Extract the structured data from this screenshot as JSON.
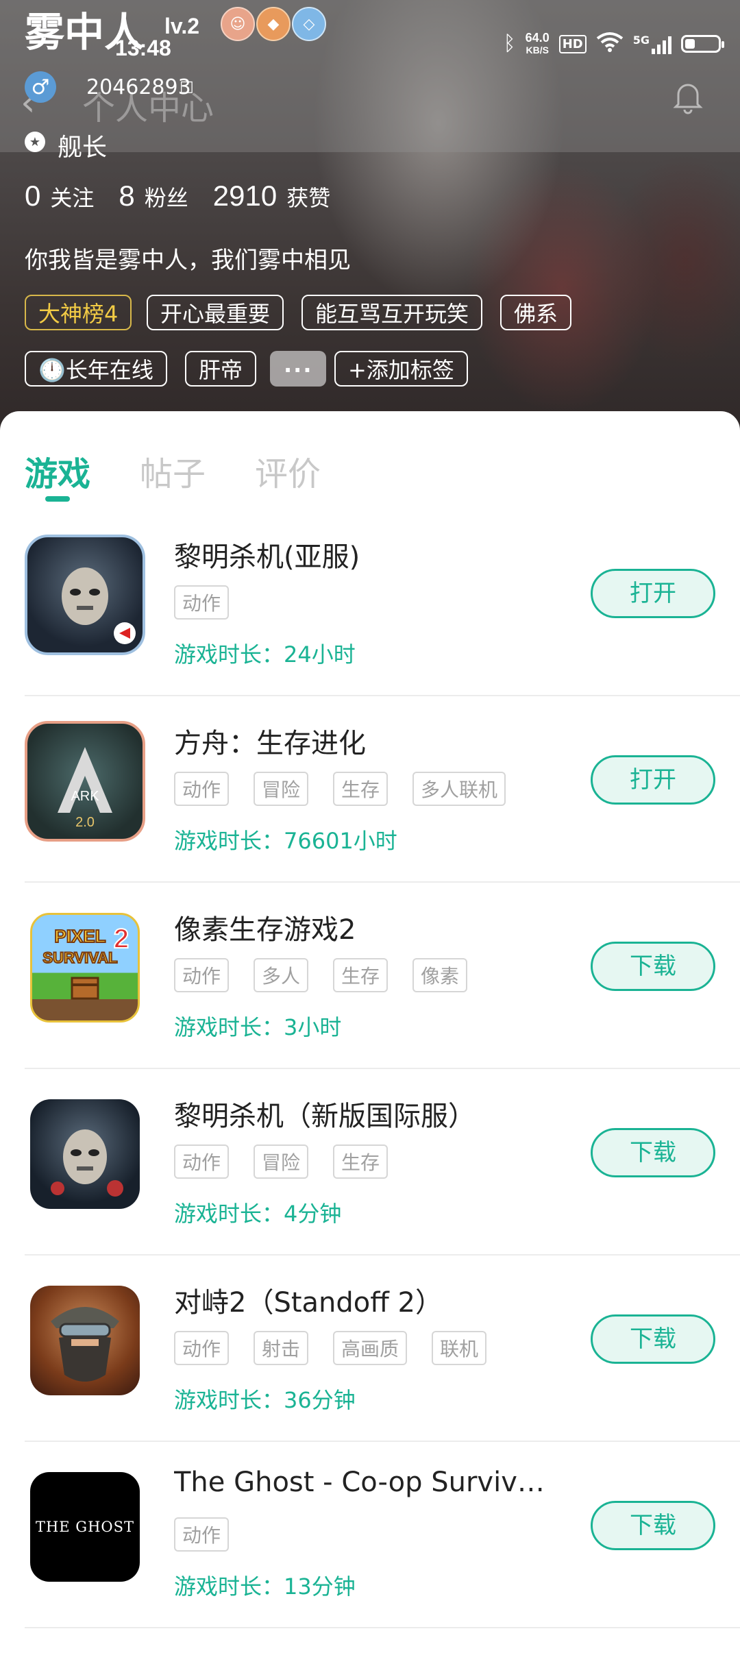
{
  "status_bar": {
    "time": "13:48",
    "net_speed_value": "64.0",
    "net_speed_unit": "KB/S",
    "hd": "HD",
    "signal": "5G",
    "battery_level": 0.3
  },
  "profile": {
    "username": "雾中人",
    "level": "lv.2",
    "header_title": "个人中心",
    "user_id": "20462893",
    "rank": "舰长",
    "stats": [
      {
        "num": "0",
        "label": "关注"
      },
      {
        "num": "8",
        "label": "粉丝"
      },
      {
        "num": "2910",
        "label": "获赞"
      }
    ],
    "bio": "你我皆是雾中人，我们雾中相见",
    "tags": [
      "大神榜4",
      "开心最重要",
      "能互骂互开玩笑",
      "佛系",
      "🕛长年在线",
      "肝帝",
      "···",
      "+添加标签"
    ]
  },
  "tabs": [
    "游戏",
    "帖子",
    "评价"
  ],
  "games": [
    {
      "name": "黎明杀机(亚服)",
      "tags": [
        "动作"
      ],
      "playtime": "游戏时长：24小时",
      "button": "打开"
    },
    {
      "name": "方舟：生存进化",
      "tags": [
        "动作",
        "冒险",
        "生存",
        "多人联机"
      ],
      "playtime": "游戏时长：76601小时",
      "button": "打开"
    },
    {
      "name": "像素生存游戏2",
      "tags": [
        "动作",
        "多人",
        "生存",
        "像素"
      ],
      "playtime": "游戏时长：3小时",
      "button": "下载"
    },
    {
      "name": "黎明杀机（新版国际服）",
      "tags": [
        "动作",
        "冒险",
        "生存"
      ],
      "playtime": "游戏时长：4分钟",
      "button": "下载"
    },
    {
      "name": "对峙2（Standoff 2）",
      "tags": [
        "动作",
        "射击",
        "高画质",
        "联机"
      ],
      "playtime": "游戏时长：36分钟",
      "button": "下载"
    },
    {
      "name": "The Ghost - Co-op Survival H...",
      "tags": [
        "动作"
      ],
      "playtime": "游戏时长：13分钟",
      "button": "下载"
    }
  ],
  "icon_texts": {
    "ark": "ARK",
    "ark_version": "2.0",
    "pixel_line1": "PIXEL",
    "pixel_line2": "SURVIVAL",
    "pixel_num": "2",
    "ghost": "THE GHOST"
  }
}
